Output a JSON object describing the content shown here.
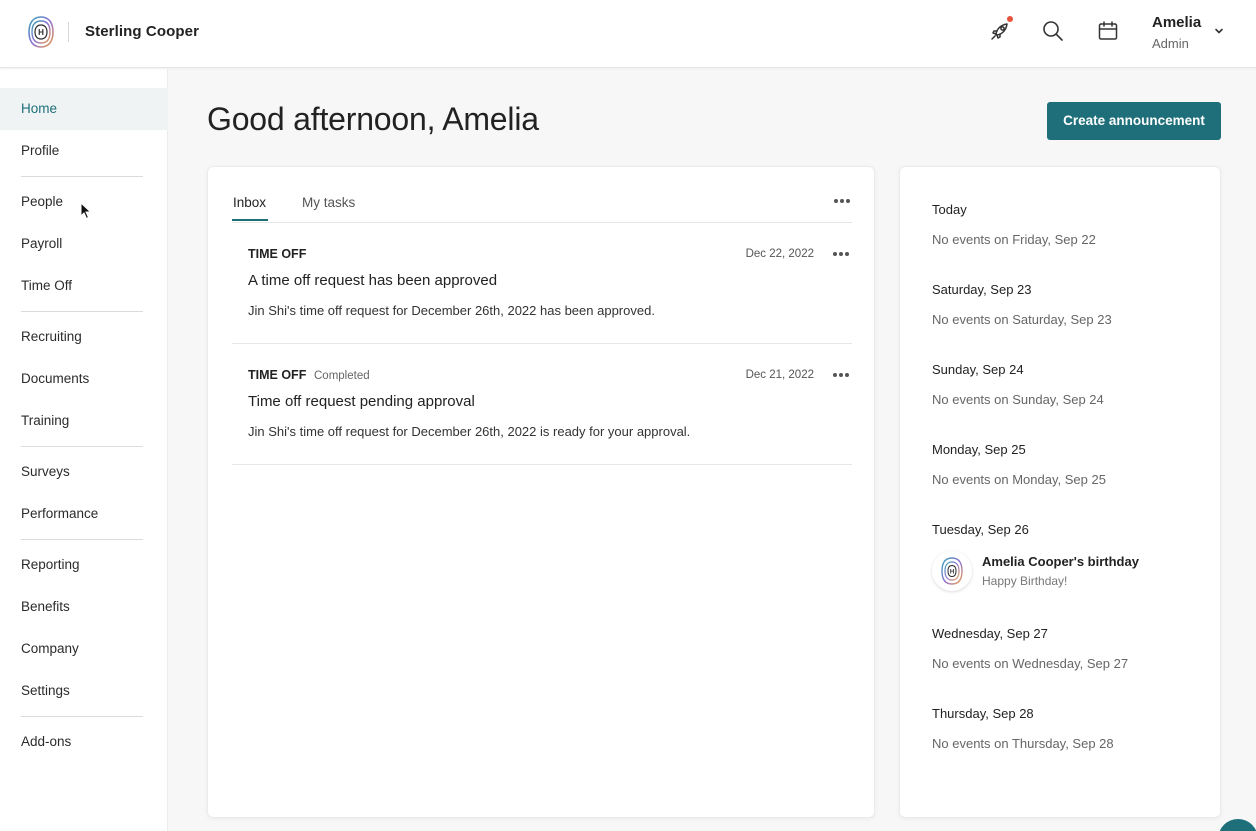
{
  "header": {
    "company_name": "Sterling Cooper",
    "user_name": "Amelia",
    "user_role": "Admin",
    "icons": [
      "rocket-icon",
      "search-icon",
      "calendar-icon",
      "chevron-down-icon"
    ]
  },
  "sidebar": {
    "items": [
      {
        "label": "Home",
        "active": true
      },
      {
        "label": "Profile"
      },
      {
        "label": "People"
      },
      {
        "label": "Payroll"
      },
      {
        "label": "Time Off"
      },
      {
        "label": "Recruiting"
      },
      {
        "label": "Documents"
      },
      {
        "label": "Training"
      },
      {
        "label": "Surveys"
      },
      {
        "label": "Performance"
      },
      {
        "label": "Reporting"
      },
      {
        "label": "Benefits"
      },
      {
        "label": "Company"
      },
      {
        "label": "Settings"
      },
      {
        "label": "Add-ons"
      }
    ]
  },
  "main": {
    "greeting": "Good afternoon, Amelia",
    "create_button": "Create announcement",
    "tabs": [
      {
        "label": "Inbox",
        "active": true
      },
      {
        "label": "My tasks"
      }
    ],
    "messages": [
      {
        "category": "TIME OFF",
        "status": "",
        "date": "Dec 22, 2022",
        "title": "A time off request has been approved",
        "body": "Jin Shi's time off request for December 26th, 2022 has been approved."
      },
      {
        "category": "TIME OFF",
        "status": "Completed",
        "date": "Dec 21, 2022",
        "title": "Time off request pending approval",
        "body": "Jin Shi's time off request for December 26th, 2022 is ready for your approval."
      }
    ]
  },
  "calendar": {
    "days": [
      {
        "label": "Today",
        "note": "No events on Friday, Sep 22"
      },
      {
        "label": "Saturday, Sep 23",
        "note": "No events on Saturday, Sep 23"
      },
      {
        "label": "Sunday, Sep 24",
        "note": "No events on Sunday, Sep 24"
      },
      {
        "label": "Monday, Sep 25",
        "note": "No events on Monday, Sep 25"
      },
      {
        "label": "Tuesday, Sep 26",
        "event_title": "Amelia Cooper's birthday",
        "event_sub": "Happy Birthday!"
      },
      {
        "label": "Wednesday, Sep 27",
        "note": "No events on Wednesday, Sep 27"
      },
      {
        "label": "Thursday, Sep 28",
        "note": "No events on Thursday, Sep 28"
      }
    ]
  },
  "colors": {
    "accent": "#1f6f7a",
    "notification": "#e5533b",
    "active_nav_bg": "#eff3f4"
  }
}
